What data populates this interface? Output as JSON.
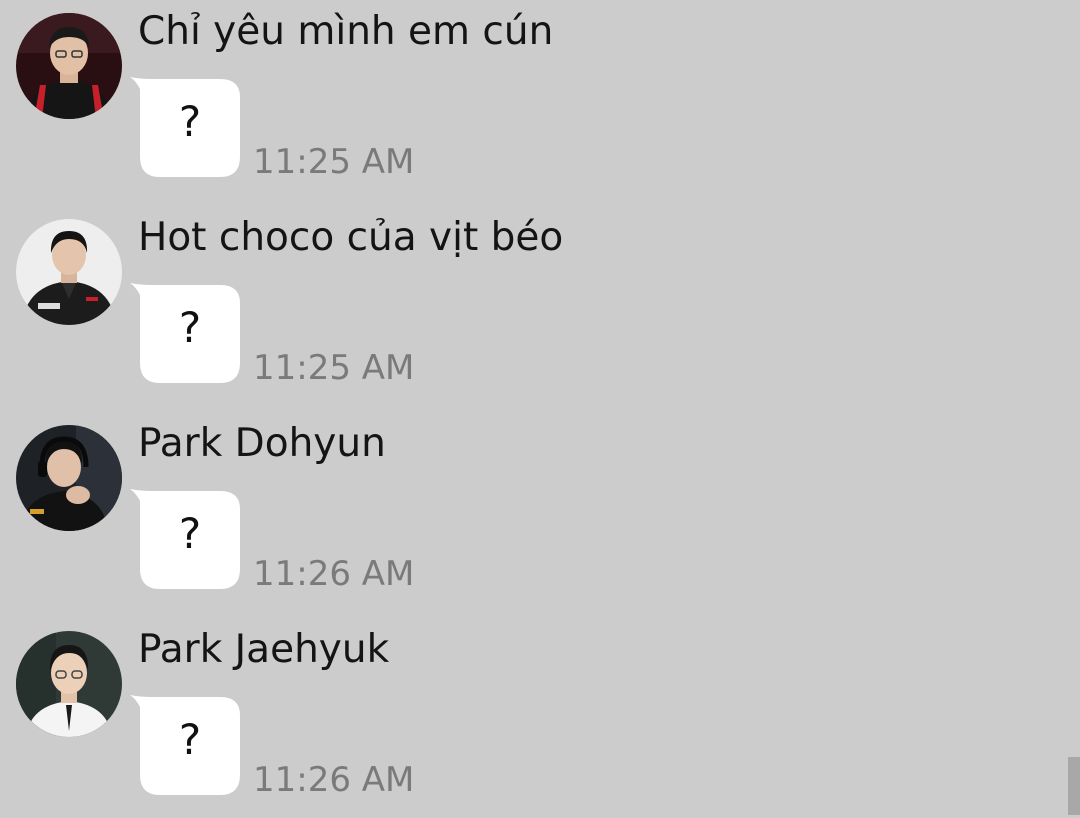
{
  "messages": [
    {
      "sender": "Chỉ yêu mình em cún",
      "text": "?",
      "time": "11:25 AM",
      "avatar_icon": "profile-photo-red-jersey"
    },
    {
      "sender": "Hot choco của vịt béo",
      "text": "?",
      "time": "11:25 AM",
      "avatar_icon": "profile-photo-black-jacket"
    },
    {
      "sender": "Park Dohyun",
      "text": "?",
      "time": "11:26 AM",
      "avatar_icon": "profile-photo-headset"
    },
    {
      "sender": "Park Jaehyuk",
      "text": "?",
      "time": "11:26 AM",
      "avatar_icon": "profile-photo-white-shirt"
    }
  ],
  "colors": {
    "background": "#cccccc",
    "bubble": "#ffffff",
    "sender_text": "#141414",
    "time_text": "#7a7a7a"
  }
}
